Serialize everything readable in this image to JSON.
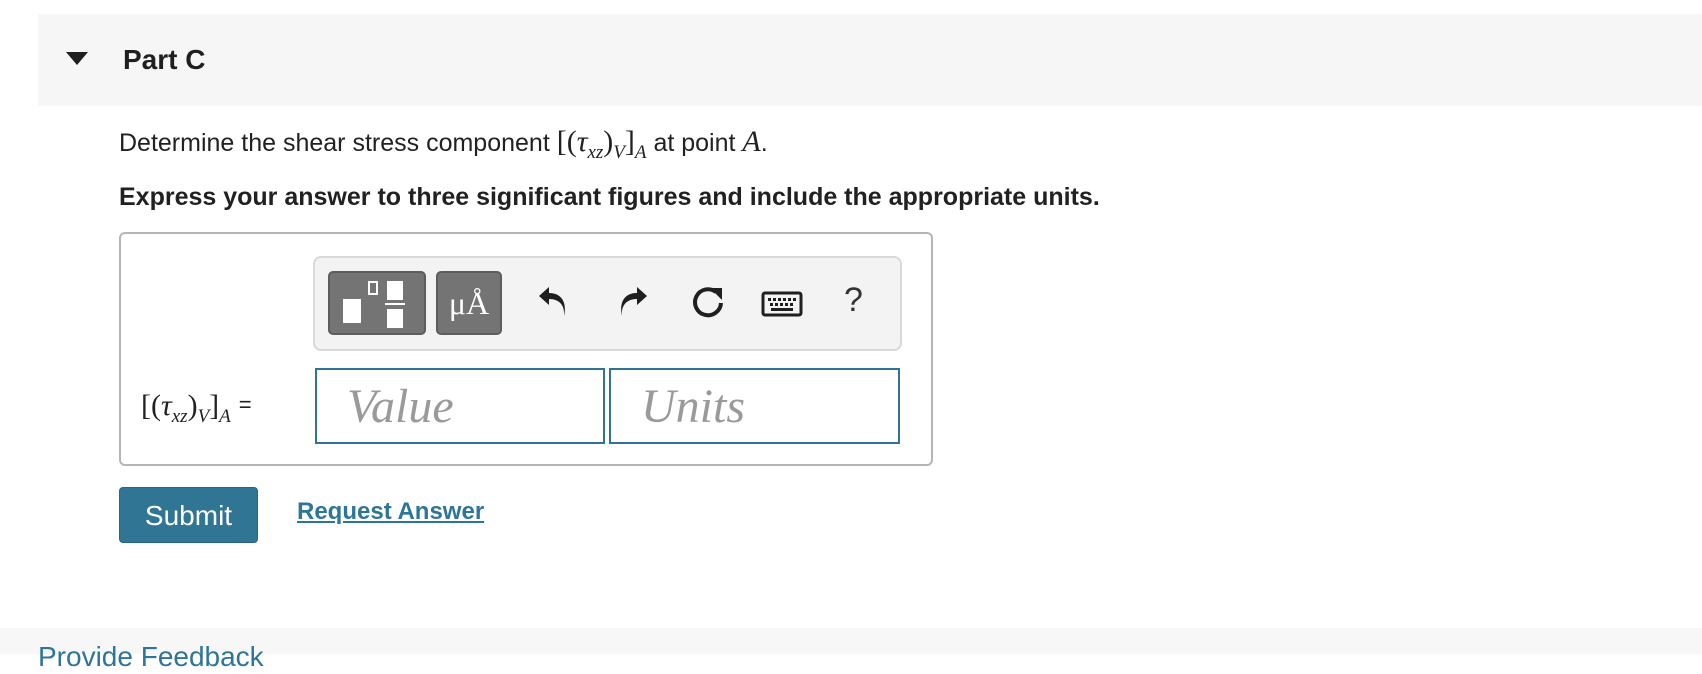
{
  "part": {
    "title": "Part C"
  },
  "question": {
    "prefix": "Determine the shear stress component",
    "symbol_tau": "τ",
    "symbol_sub_xz": "xz",
    "symbol_sub_v": "V",
    "symbol_sub_a": "A",
    "middle": "at point",
    "point": "A",
    "suffix": "."
  },
  "instruction": "Express your answer to three significant figures and include the appropriate units.",
  "toolbar": {
    "units_label": "μÅ",
    "help_label": "?",
    "icons": [
      "templates-icon",
      "units-icon",
      "undo-icon",
      "redo-icon",
      "reset-icon",
      "keyboard-icon",
      "help-icon"
    ]
  },
  "answer": {
    "equals": "=",
    "value_placeholder": "Value",
    "units_placeholder": "Units"
  },
  "actions": {
    "submit_label": "Submit",
    "request_label": "Request Answer"
  },
  "footer": {
    "feedback_label": "Provide Feedback"
  },
  "colors": {
    "accent": "#307694",
    "link": "#2d7699",
    "input_border": "#2f7396"
  }
}
